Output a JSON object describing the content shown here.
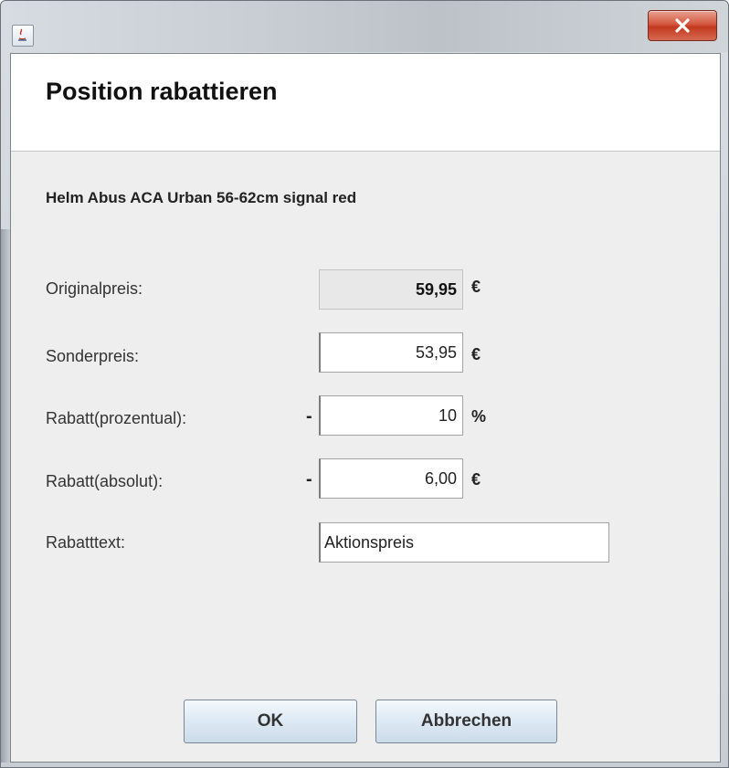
{
  "window": {
    "close_icon": "close-x-icon",
    "app_icon": "java-icon"
  },
  "header": {
    "title": "Position rabattieren"
  },
  "product": {
    "name": "Helm Abus ACA Urban 56-62cm signal red"
  },
  "form": {
    "original": {
      "label": "Originalpreis:",
      "value": "59,95",
      "unit": "€"
    },
    "sonder": {
      "label": "Sonderpreis:",
      "value": "53,95",
      "unit": "€"
    },
    "rabatt_prozent": {
      "label": "Rabatt(prozentual):",
      "sign": "-",
      "value": "10",
      "unit": "%"
    },
    "rabatt_absolut": {
      "label": "Rabatt(absolut):",
      "sign": "-",
      "value": "6,00",
      "unit": "€"
    },
    "rabatttext": {
      "label": "Rabatttext:",
      "value": "Aktionspreis"
    }
  },
  "buttons": {
    "ok": "OK",
    "cancel": "Abbrechen"
  }
}
